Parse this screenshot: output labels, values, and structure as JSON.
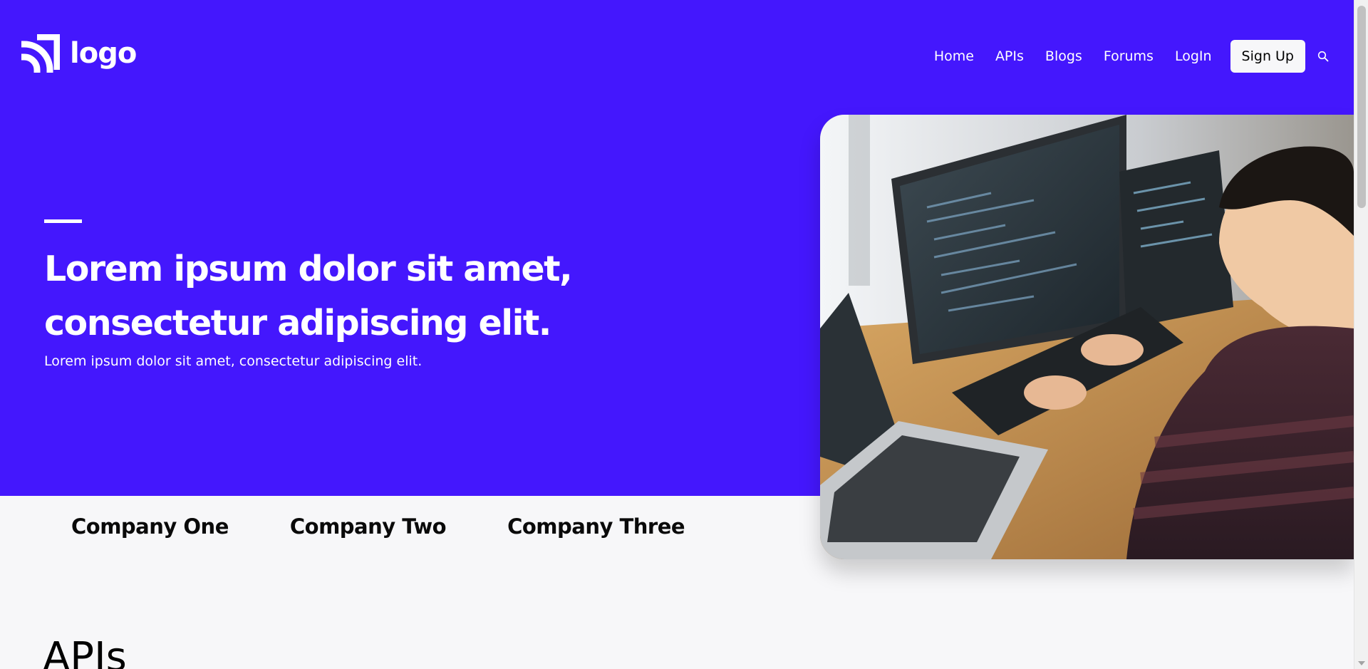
{
  "header": {
    "logo_text": "logo",
    "nav": [
      {
        "label": "Home"
      },
      {
        "label": "APIs"
      },
      {
        "label": "Blogs"
      },
      {
        "label": "Forums"
      },
      {
        "label": "LogIn"
      }
    ],
    "signup_label": "Sign Up",
    "search_icon": "search-icon"
  },
  "hero": {
    "title": "Lorem ipsum dolor sit amet, consectetur adipiscing elit.",
    "subtitle": "Lorem ipsum dolor sit amet, consectetur adipiscing elit.",
    "image_subject": "developer-at-computer-photo"
  },
  "companies": [
    {
      "name": "Company One"
    },
    {
      "name": "Company Two"
    },
    {
      "name": "Company Three"
    }
  ],
  "section": {
    "title": "APIs"
  },
  "colors": {
    "brand": "#4417fd",
    "background": "#f7f7f9",
    "button_bg": "#f7f7f9",
    "text_light": "#ffffff",
    "text_dark": "#000000"
  }
}
